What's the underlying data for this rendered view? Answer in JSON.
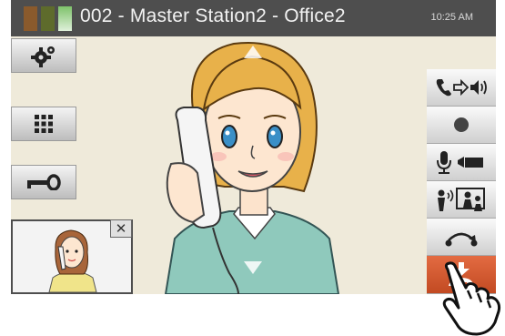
{
  "header": {
    "station_title": "002 - Master Station2 - Office2",
    "time": "10:25 AM"
  },
  "left_controls": [
    {
      "id": "settings",
      "icon": "gear-icon"
    },
    {
      "id": "keypad",
      "icon": "keypad-icon"
    },
    {
      "id": "door-release",
      "icon": "key-icon"
    }
  ],
  "right_controls": [
    {
      "id": "volume",
      "icon": "handset-to-speaker-icon"
    },
    {
      "id": "record",
      "icon": "record-dot-icon"
    },
    {
      "id": "mic-camera",
      "icon": "microphone-camera-icon"
    },
    {
      "id": "transfer",
      "icon": "transfer-icon"
    },
    {
      "id": "hold",
      "icon": "hold-icon"
    },
    {
      "id": "hang-up",
      "icon": "hang-up-icon"
    }
  ],
  "pip": {
    "close_label": "✕"
  },
  "colors": {
    "accent_hangup": "#d95a2e",
    "topbar": "#4e4e4e"
  }
}
